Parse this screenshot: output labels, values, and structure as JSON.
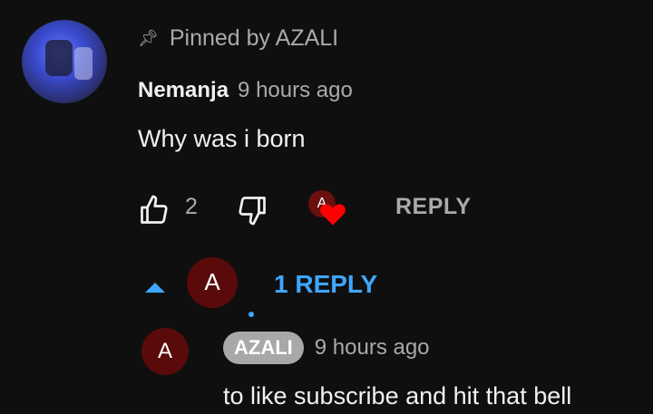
{
  "comment": {
    "pinned_label": "Pinned by AZALI",
    "author": "Nemanja",
    "time": "9 hours ago",
    "text": "Why was i born",
    "like_count": "2",
    "reply_label": "REPLY",
    "heart_avatar_letter": "A",
    "icons": {
      "pin": "pin-icon",
      "like": "thumb-up-icon",
      "dislike": "thumb-down-icon",
      "heart": "heart-icon"
    },
    "heart_color": "#ff0000"
  },
  "replies": {
    "avatar_letter": "A",
    "toggle_label": "1 REPLY",
    "accent_color": "#3ea6ff"
  },
  "reply": {
    "avatar_letter": "A",
    "author": "AZALI",
    "time": "9 hours ago",
    "text": "to like subscribe and hit that bell"
  }
}
